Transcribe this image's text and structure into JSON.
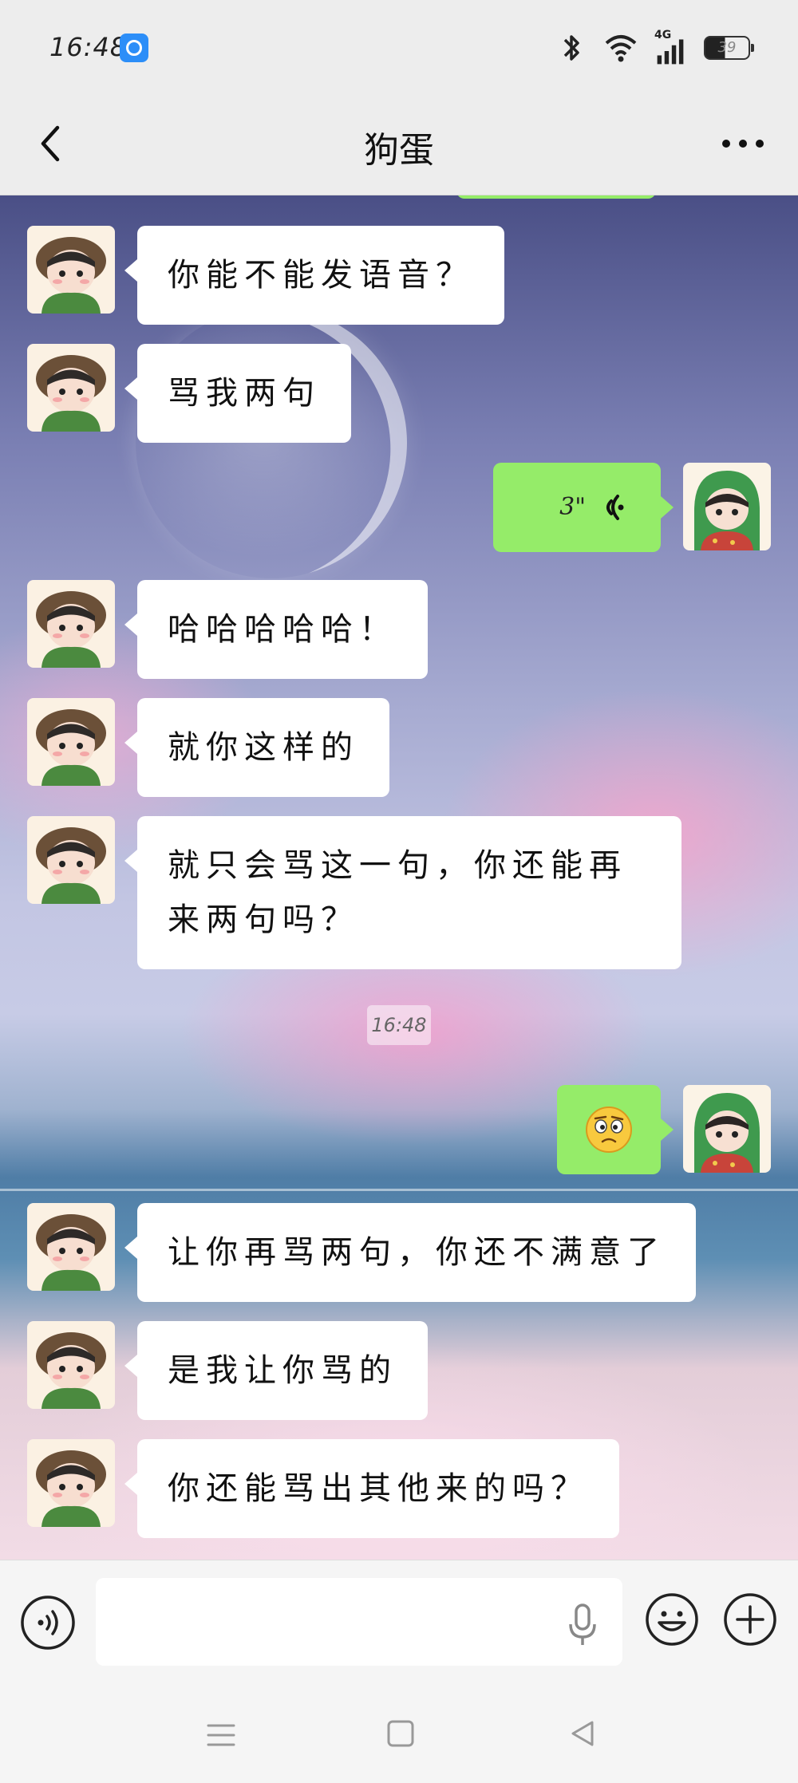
{
  "status_bar": {
    "time": "16:48",
    "network_label": "4G",
    "battery_level": "39"
  },
  "header": {
    "title": "狗蛋"
  },
  "messages": [
    {
      "side": "left",
      "kind": "text",
      "text": "你能不能发语音？"
    },
    {
      "side": "left",
      "kind": "text",
      "text": "骂我两句"
    },
    {
      "side": "right",
      "kind": "voice",
      "text": "3\""
    },
    {
      "side": "left",
      "kind": "text",
      "text": "哈哈哈哈哈！"
    },
    {
      "side": "left",
      "kind": "text",
      "text": "就你这样的"
    },
    {
      "side": "left",
      "kind": "text",
      "text": "就只会骂这一句，你还能再来两句吗？"
    },
    {
      "side": "center",
      "kind": "timestamp",
      "text": "16:48"
    },
    {
      "side": "right",
      "kind": "emoji",
      "text": "",
      "icon": "confused-face-icon"
    },
    {
      "side": "left",
      "kind": "text",
      "text": "让你再骂两句，你还不满意了"
    },
    {
      "side": "left",
      "kind": "text",
      "text": "是我让你骂的"
    },
    {
      "side": "left",
      "kind": "text",
      "text": "你还能骂出其他来的吗？"
    }
  ],
  "input_bar": {
    "value": "",
    "placeholder": ""
  },
  "colors": {
    "outgoing_bubble": "#95ec69",
    "incoming_bubble": "#ffffff",
    "bar_background": "#ededed"
  }
}
